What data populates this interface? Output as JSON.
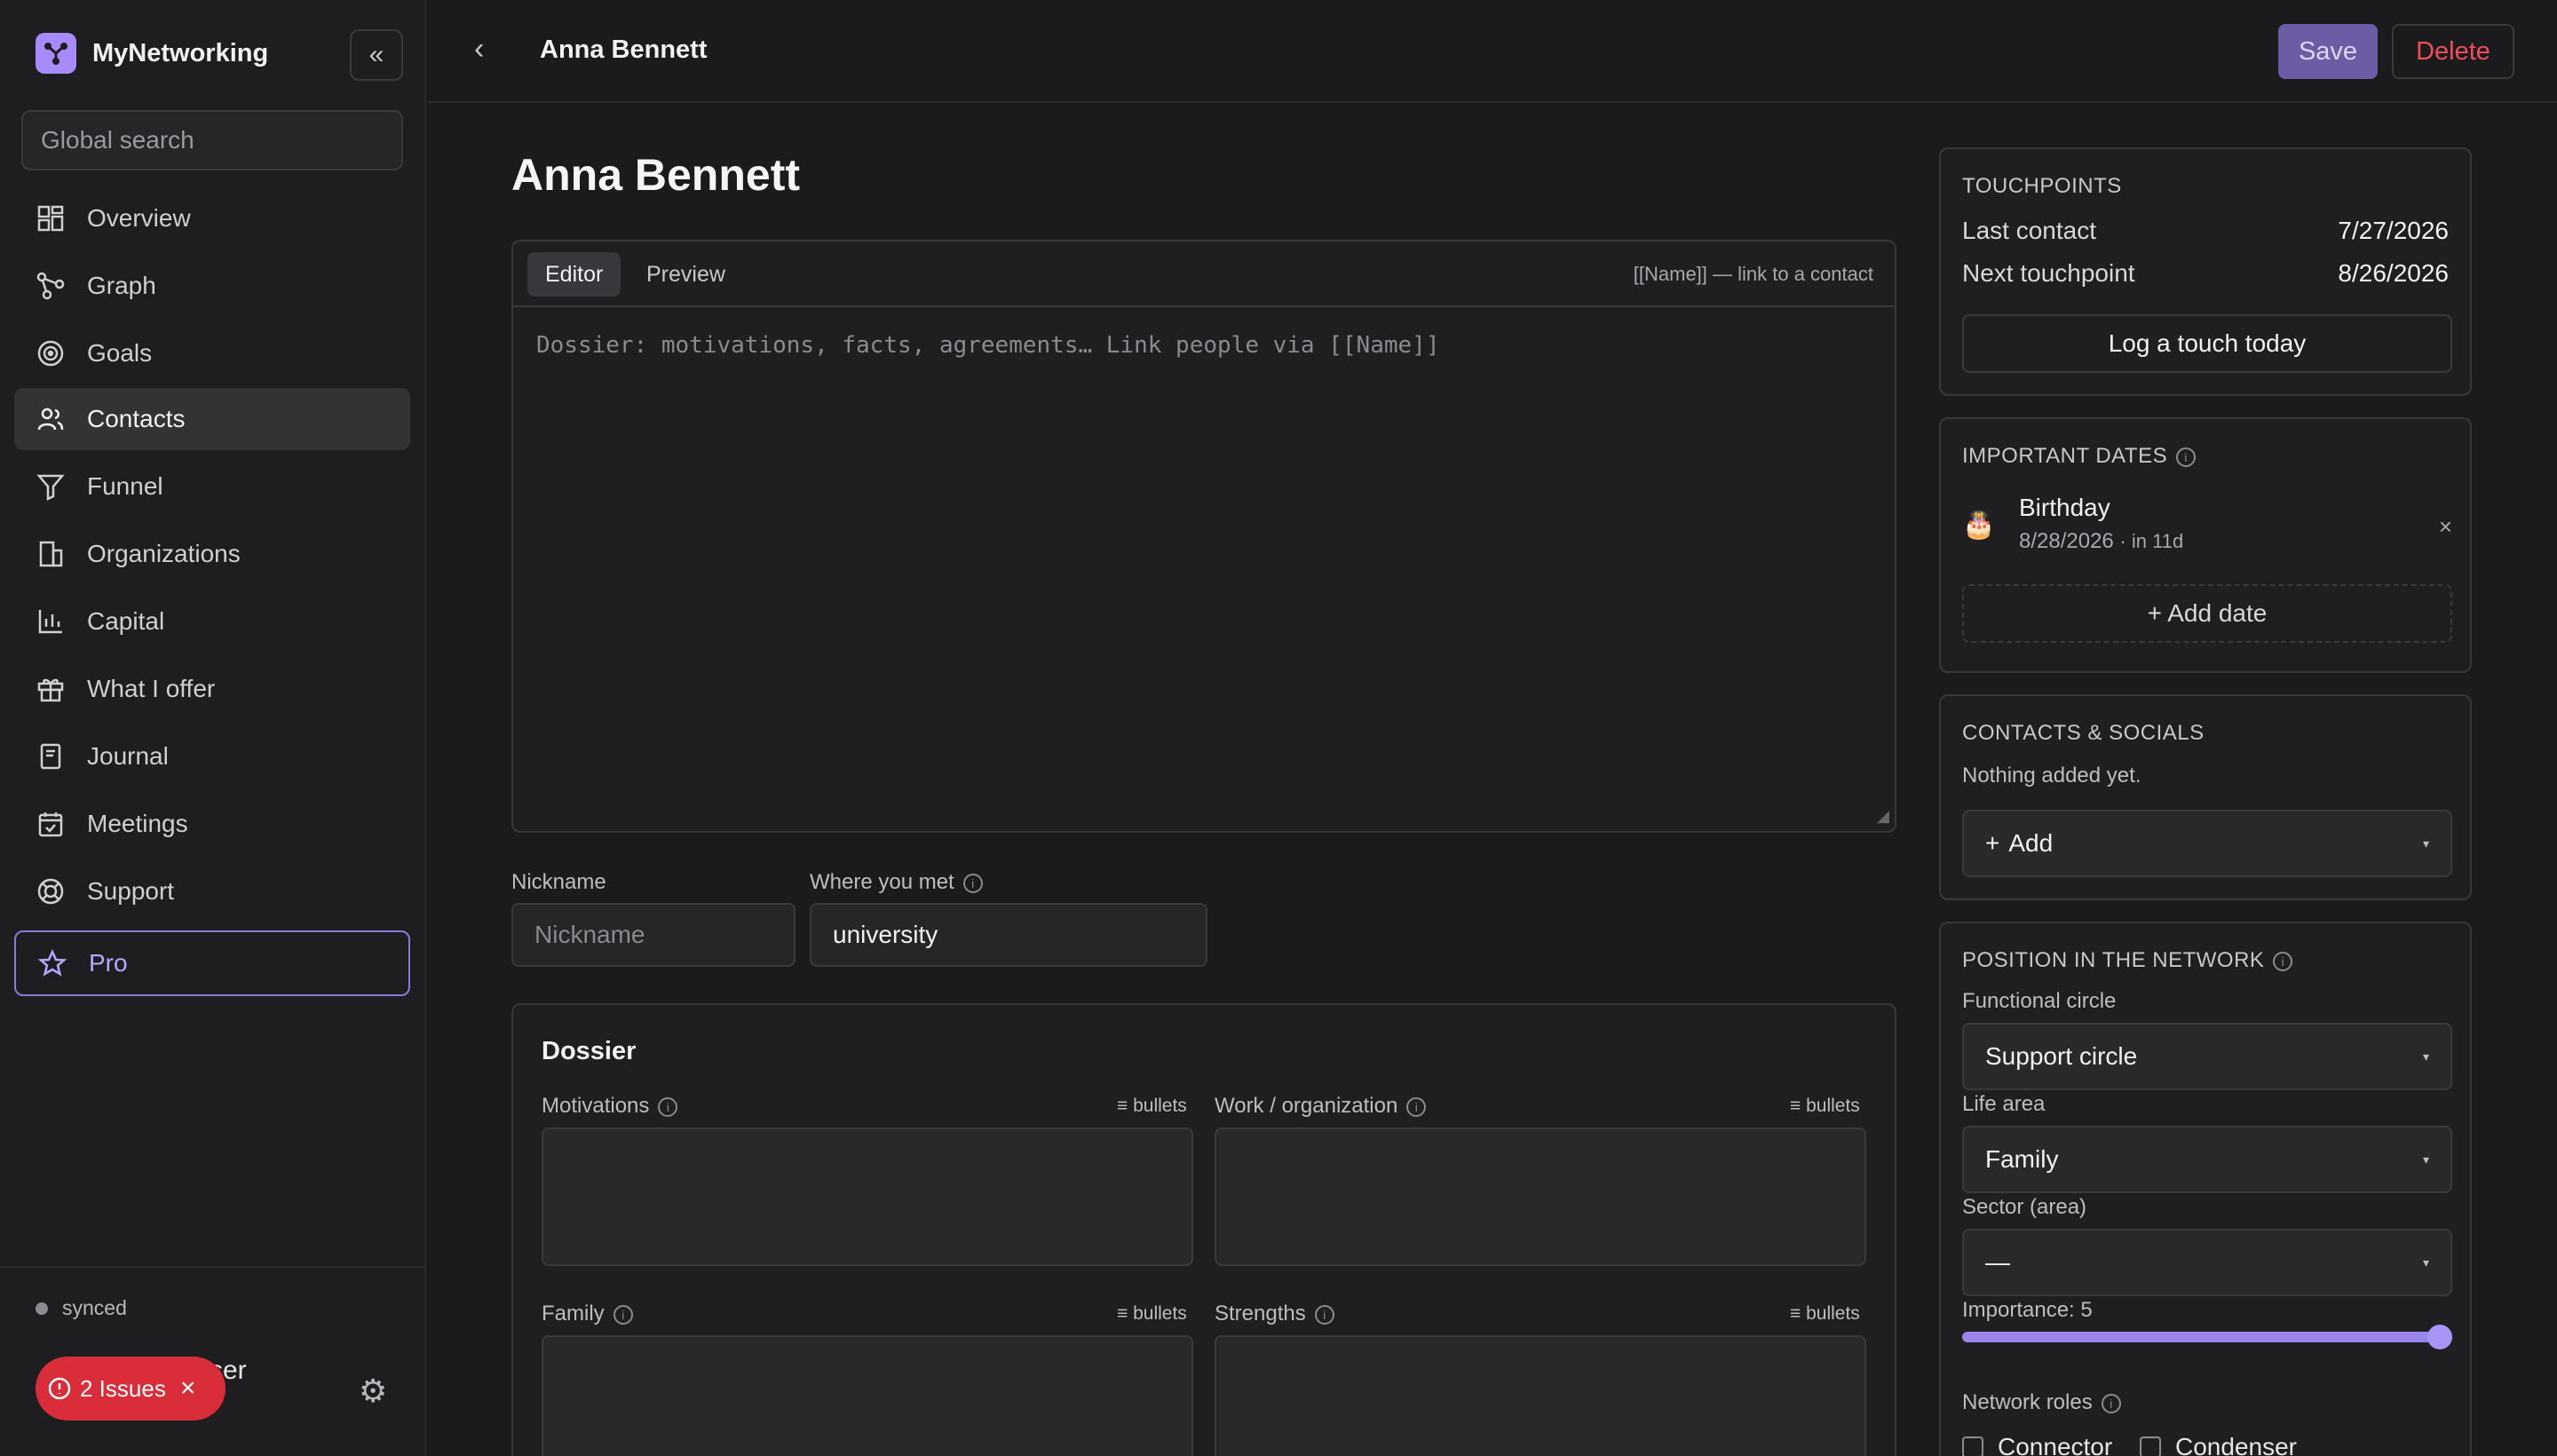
{
  "app": {
    "name": "MyNetworking"
  },
  "sidebar": {
    "search_placeholder": "Global search",
    "items": [
      {
        "label": "Overview",
        "icon": "grid-icon"
      },
      {
        "label": "Graph",
        "icon": "graph-icon"
      },
      {
        "label": "Goals",
        "icon": "target-icon"
      },
      {
        "label": "Contacts",
        "icon": "users-icon",
        "active": true
      },
      {
        "label": "Funnel",
        "icon": "filter-icon"
      },
      {
        "label": "Organizations",
        "icon": "building-icon"
      },
      {
        "label": "Capital",
        "icon": "bar-chart-icon"
      },
      {
        "label": "What I offer",
        "icon": "gift-icon"
      },
      {
        "label": "Journal",
        "icon": "notebook-icon"
      },
      {
        "label": "Meetings",
        "icon": "calendar-icon"
      },
      {
        "label": "Support",
        "icon": "lifebuoy-icon"
      },
      {
        "label": "Pro",
        "icon": "star-icon"
      }
    ],
    "sync_status": "synced",
    "user_name_visible": "ser",
    "issues_label": "2 Issues"
  },
  "topbar": {
    "title": "Anna Bennett",
    "save_label": "Save",
    "delete_label": "Delete"
  },
  "main": {
    "page_title": "Anna Bennett",
    "editor": {
      "tabs": [
        "Editor",
        "Preview"
      ],
      "hint": "[[Name]] — link to a contact",
      "placeholder": "Dossier: motivations, facts, agreements… Link people via [[Name]]"
    },
    "nickname": {
      "label": "Nickname",
      "placeholder": "Nickname",
      "value": ""
    },
    "where_met": {
      "label": "Where you met",
      "value": "university"
    },
    "dossier": {
      "title": "Dossier",
      "bullets_label": "≡ bullets",
      "fields": [
        "Motivations",
        "Work / organization",
        "Family",
        "Strengths"
      ]
    }
  },
  "right": {
    "touchpoints": {
      "heading": "TOUCHPOINTS",
      "last_contact_label": "Last contact",
      "last_contact": "7/27/2026",
      "next_label": "Next touchpoint",
      "next": "8/26/2026",
      "log_button": "Log a touch today"
    },
    "important_dates": {
      "heading": "IMPORTANT DATES",
      "items": [
        {
          "name": "Birthday",
          "date": "8/28/2026",
          "relative": "· in 11d",
          "icon": "cake-icon"
        }
      ],
      "add_label": "+ Add date"
    },
    "contacts_socials": {
      "heading": "CONTACTS & SOCIALS",
      "empty": "Nothing added yet.",
      "add_label": "Add"
    },
    "network_position": {
      "heading": "POSITION IN THE NETWORK",
      "functional_circle_label": "Functional circle",
      "functional_circle": "Support circle",
      "life_area_label": "Life area",
      "life_area": "Family",
      "sector_label": "Sector (area)",
      "sector": "—",
      "importance_label": "Importance: 5",
      "importance": 5,
      "importance_max": 5,
      "roles_label": "Network roles",
      "roles": [
        "Connector",
        "Condenser"
      ]
    }
  },
  "colors": {
    "accent": "#a78bfa",
    "danger": "#ef4c5c",
    "background": "#1b1b1d"
  }
}
